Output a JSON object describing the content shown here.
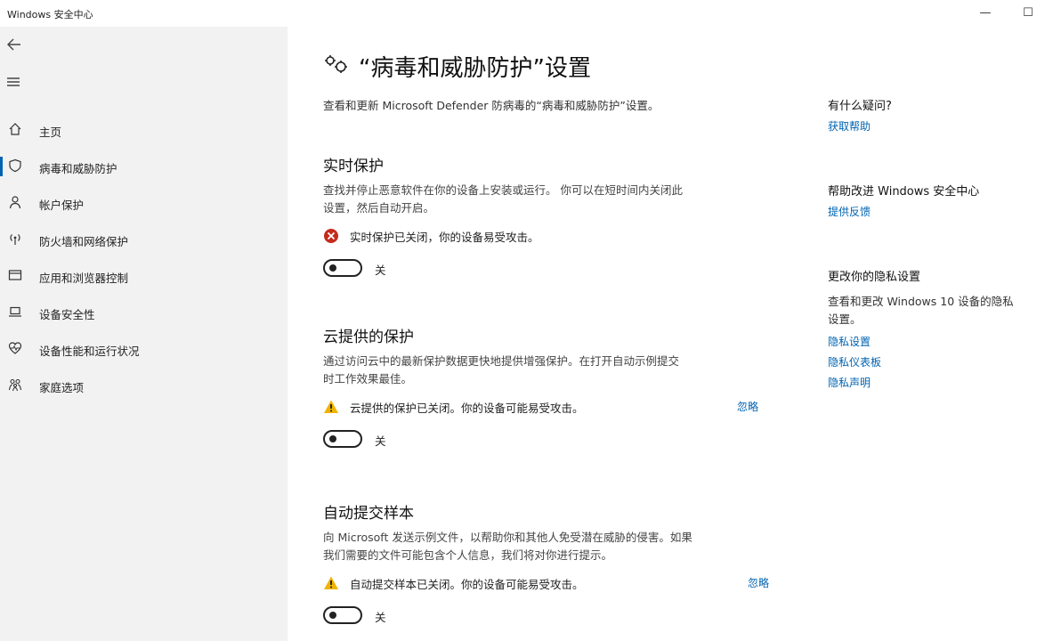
{
  "window": {
    "title": "Windows 安全中心",
    "minimize": "—",
    "maximize": "☐"
  },
  "sidebar": {
    "back_icon": "back-arrow-icon",
    "menu_icon": "hamburger-menu-icon",
    "items": [
      {
        "label": "主页",
        "icon": "home-icon"
      },
      {
        "label": "病毒和威胁防护",
        "icon": "shield-icon",
        "active": true
      },
      {
        "label": "帐户保护",
        "icon": "person-icon"
      },
      {
        "label": "防火墙和网络保护",
        "icon": "wifi-antenna-icon"
      },
      {
        "label": "应用和浏览器控制",
        "icon": "browser-window-icon"
      },
      {
        "label": "设备安全性",
        "icon": "laptop-icon"
      },
      {
        "label": "设备性能和运行状况",
        "icon": "heart-pulse-icon"
      },
      {
        "label": "家庭选项",
        "icon": "family-icon"
      }
    ]
  },
  "main": {
    "title_icon": "gears-icon",
    "title": "“病毒和威胁防护”设置",
    "description": "查看和更新 Microsoft Defender 防病毒的“病毒和威胁防护”设置。",
    "sections": [
      {
        "title": "实时保护",
        "desc_line1": "查找并停止恶意软件在你的设备上安装或运行。 你可以在短时间内关闭此",
        "desc_line2": "设置，然后自动开启。",
        "status_icon": "error-x-icon",
        "status_text": "实时保护已关闭，你的设备易受攻击。",
        "toggle_state": "关"
      },
      {
        "title": "云提供的保护",
        "desc_line1": "通过访问云中的最新保护数据更快地提供增强保护。在打开自动示例提交",
        "desc_line2": "时工作效果最佳。",
        "status_icon": "warning-triangle-icon",
        "status_text": "云提供的保护已关闭。你的设备可能易受攻击。",
        "ignore": "忽略",
        "toggle_state": "关"
      },
      {
        "title": "自动提交样本",
        "desc_line1": "向 Microsoft 发送示例文件，以帮助你和其他人免受潜在威胁的侵害。如果",
        "desc_line2": "我们需要的文件可能包含个人信息，我们将对你进行提示。",
        "status_icon": "warning-triangle-icon",
        "status_text": "自动提交样本已关闭。你的设备可能易受攻击。",
        "ignore": "忽略",
        "toggle_state": "关"
      }
    ]
  },
  "side": {
    "help": {
      "heading": "有什么疑问?",
      "link": "获取帮助"
    },
    "improve": {
      "heading": "帮助改进 Windows 安全中心",
      "link": "提供反馈"
    },
    "privacy": {
      "heading": "更改你的隐私设置",
      "text_line1": "查看和更改 Windows 10 设备的隐私",
      "text_line2": "设置。",
      "links": [
        "隐私设置",
        "隐私仪表板",
        "隐私声明"
      ]
    }
  },
  "colors": {
    "accent": "#0063b1",
    "error": "#c42b1c",
    "warning": "#f0b400",
    "sidebar_bg": "#f2f2f2"
  }
}
